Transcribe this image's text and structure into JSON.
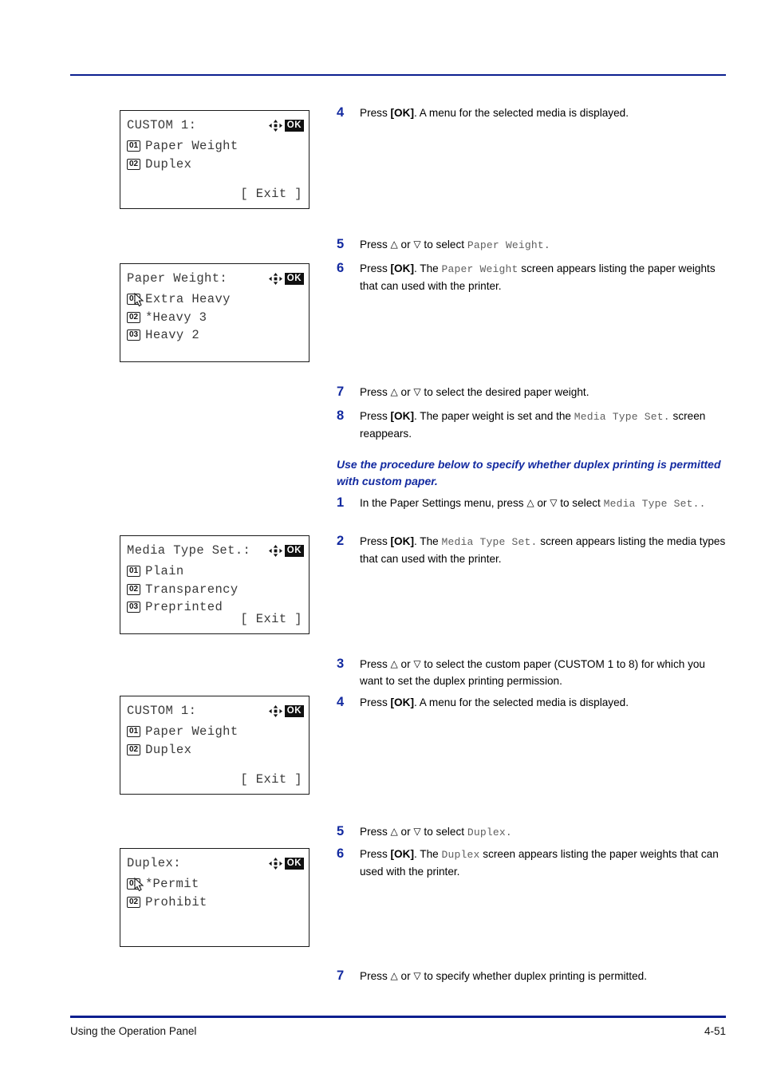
{
  "footer": {
    "section_title": "Using the Operation Panel",
    "page_number": "4-51"
  },
  "colors": {
    "accent_blue": "#132aa0",
    "rule_blue": "#0b1f8f",
    "lcd_text": "#3a3a3a",
    "mono_text": "#5e5e5e"
  },
  "panels": [
    {
      "id": "custom1-top",
      "title": "CUSTOM 1:",
      "icons": {
        "four_way": "four-way-arrow-icon",
        "ok": "OK"
      },
      "rows": [
        {
          "num": "01",
          "star": "",
          "label": "Paper Weight"
        },
        {
          "num": "02",
          "star": "",
          "label": "Duplex"
        }
      ],
      "exit": "[  Exit   ]"
    },
    {
      "id": "paper-weight",
      "title": "Paper Weight:",
      "icons": {
        "four_way": "four-way-arrow-icon",
        "ok": "OK"
      },
      "rows": [
        {
          "num": "01",
          "star": " ",
          "label": "Extra Heavy"
        },
        {
          "num": "02",
          "star": "*",
          "label": "Heavy 3"
        },
        {
          "num": "03",
          "star": " ",
          "label": "Heavy 2"
        }
      ],
      "exit": ""
    },
    {
      "id": "media-type-set",
      "title": "Media Type Set.:",
      "icons": {
        "four_way": "four-way-arrow-icon",
        "ok": "OK"
      },
      "rows": [
        {
          "num": "01",
          "star": "",
          "label": "Plain"
        },
        {
          "num": "02",
          "star": "",
          "label": "Transparency"
        },
        {
          "num": "03",
          "star": "",
          "label": "Preprinted"
        }
      ],
      "exit": "[  Exit   ]"
    },
    {
      "id": "custom1-bottom",
      "title": "CUSTOM 1:",
      "icons": {
        "four_way": "four-way-arrow-icon",
        "ok": "OK"
      },
      "rows": [
        {
          "num": "01",
          "star": "",
          "label": "Paper Weight"
        },
        {
          "num": "02",
          "star": "",
          "label": "Duplex"
        }
      ],
      "exit": "[  Exit   ]"
    },
    {
      "id": "duplex",
      "title": "Duplex:",
      "icons": {
        "four_way": "four-way-arrow-icon",
        "ok": "OK"
      },
      "rows": [
        {
          "num": "01",
          "star": "*",
          "label": "Permit"
        },
        {
          "num": "02",
          "star": " ",
          "label": "Prohibit"
        }
      ],
      "exit": ""
    }
  ],
  "steps": {
    "s4a": {
      "num": "4",
      "t1": "Press ",
      "key": "[OK]",
      "t2": ". A menu for the selected media is displayed."
    },
    "s5a": {
      "num": "5",
      "t1": "Press ",
      "up": "△",
      "t2": " or ",
      "down": "▽",
      "t3": " to select ",
      "mono": "Paper Weight",
      "t4": "."
    },
    "s6a": {
      "num": "6",
      "t1": "Press ",
      "key": "[OK]",
      "t2": ". The ",
      "mono": "Paper Weight",
      "t3": " screen appears listing the paper weights that can used with the printer."
    },
    "s7a": {
      "num": "7",
      "t1": "Press ",
      "up": "△",
      "t2": " or ",
      "down": "▽",
      "t3": " to select the desired paper weight."
    },
    "s8a": {
      "num": "8",
      "t1": "Press ",
      "key": "[OK]",
      "t2": ". The paper weight is set and the ",
      "mono": "Media Type Set.",
      "t3": " screen reappears."
    },
    "callout": "Use the procedure below to specify whether duplex printing is permitted with custom paper.",
    "s1b": {
      "num": "1",
      "t1": "In the Paper Settings menu, press ",
      "up": "△",
      "t2": " or ",
      "down": "▽",
      "t3": " to select ",
      "mono": "Media Type Set.",
      "t4": "."
    },
    "s2b": {
      "num": "2",
      "t1": "Press ",
      "key": "[OK]",
      "t2": ". The ",
      "mono": "Media Type Set.",
      "t3": " screen appears listing the media types that can used with the printer."
    },
    "s3b": {
      "num": "3",
      "t1": "Press ",
      "up": "△",
      "t2": " or ",
      "down": "▽",
      "t3": " to select the custom paper (CUSTOM 1 to 8) for which you want to set the duplex printing permission."
    },
    "s4b": {
      "num": "4",
      "t1": "Press ",
      "key": "[OK]",
      "t2": ". A menu for the selected media is displayed."
    },
    "s5b": {
      "num": "5",
      "t1": "Press ",
      "up": "△",
      "t2": " or ",
      "down": "▽",
      "t3": " to select ",
      "mono": "Duplex",
      "t4": "."
    },
    "s6b": {
      "num": "6",
      "t1": "Press ",
      "key": "[OK]",
      "t2": ". The ",
      "mono": "Duplex",
      "t3": " screen appears listing the paper weights that can used with the printer."
    },
    "s7b": {
      "num": "7",
      "t1": "Press ",
      "up": "△",
      "t2": " or ",
      "down": "▽",
      "t3": " to specify whether duplex printing is permitted."
    }
  }
}
